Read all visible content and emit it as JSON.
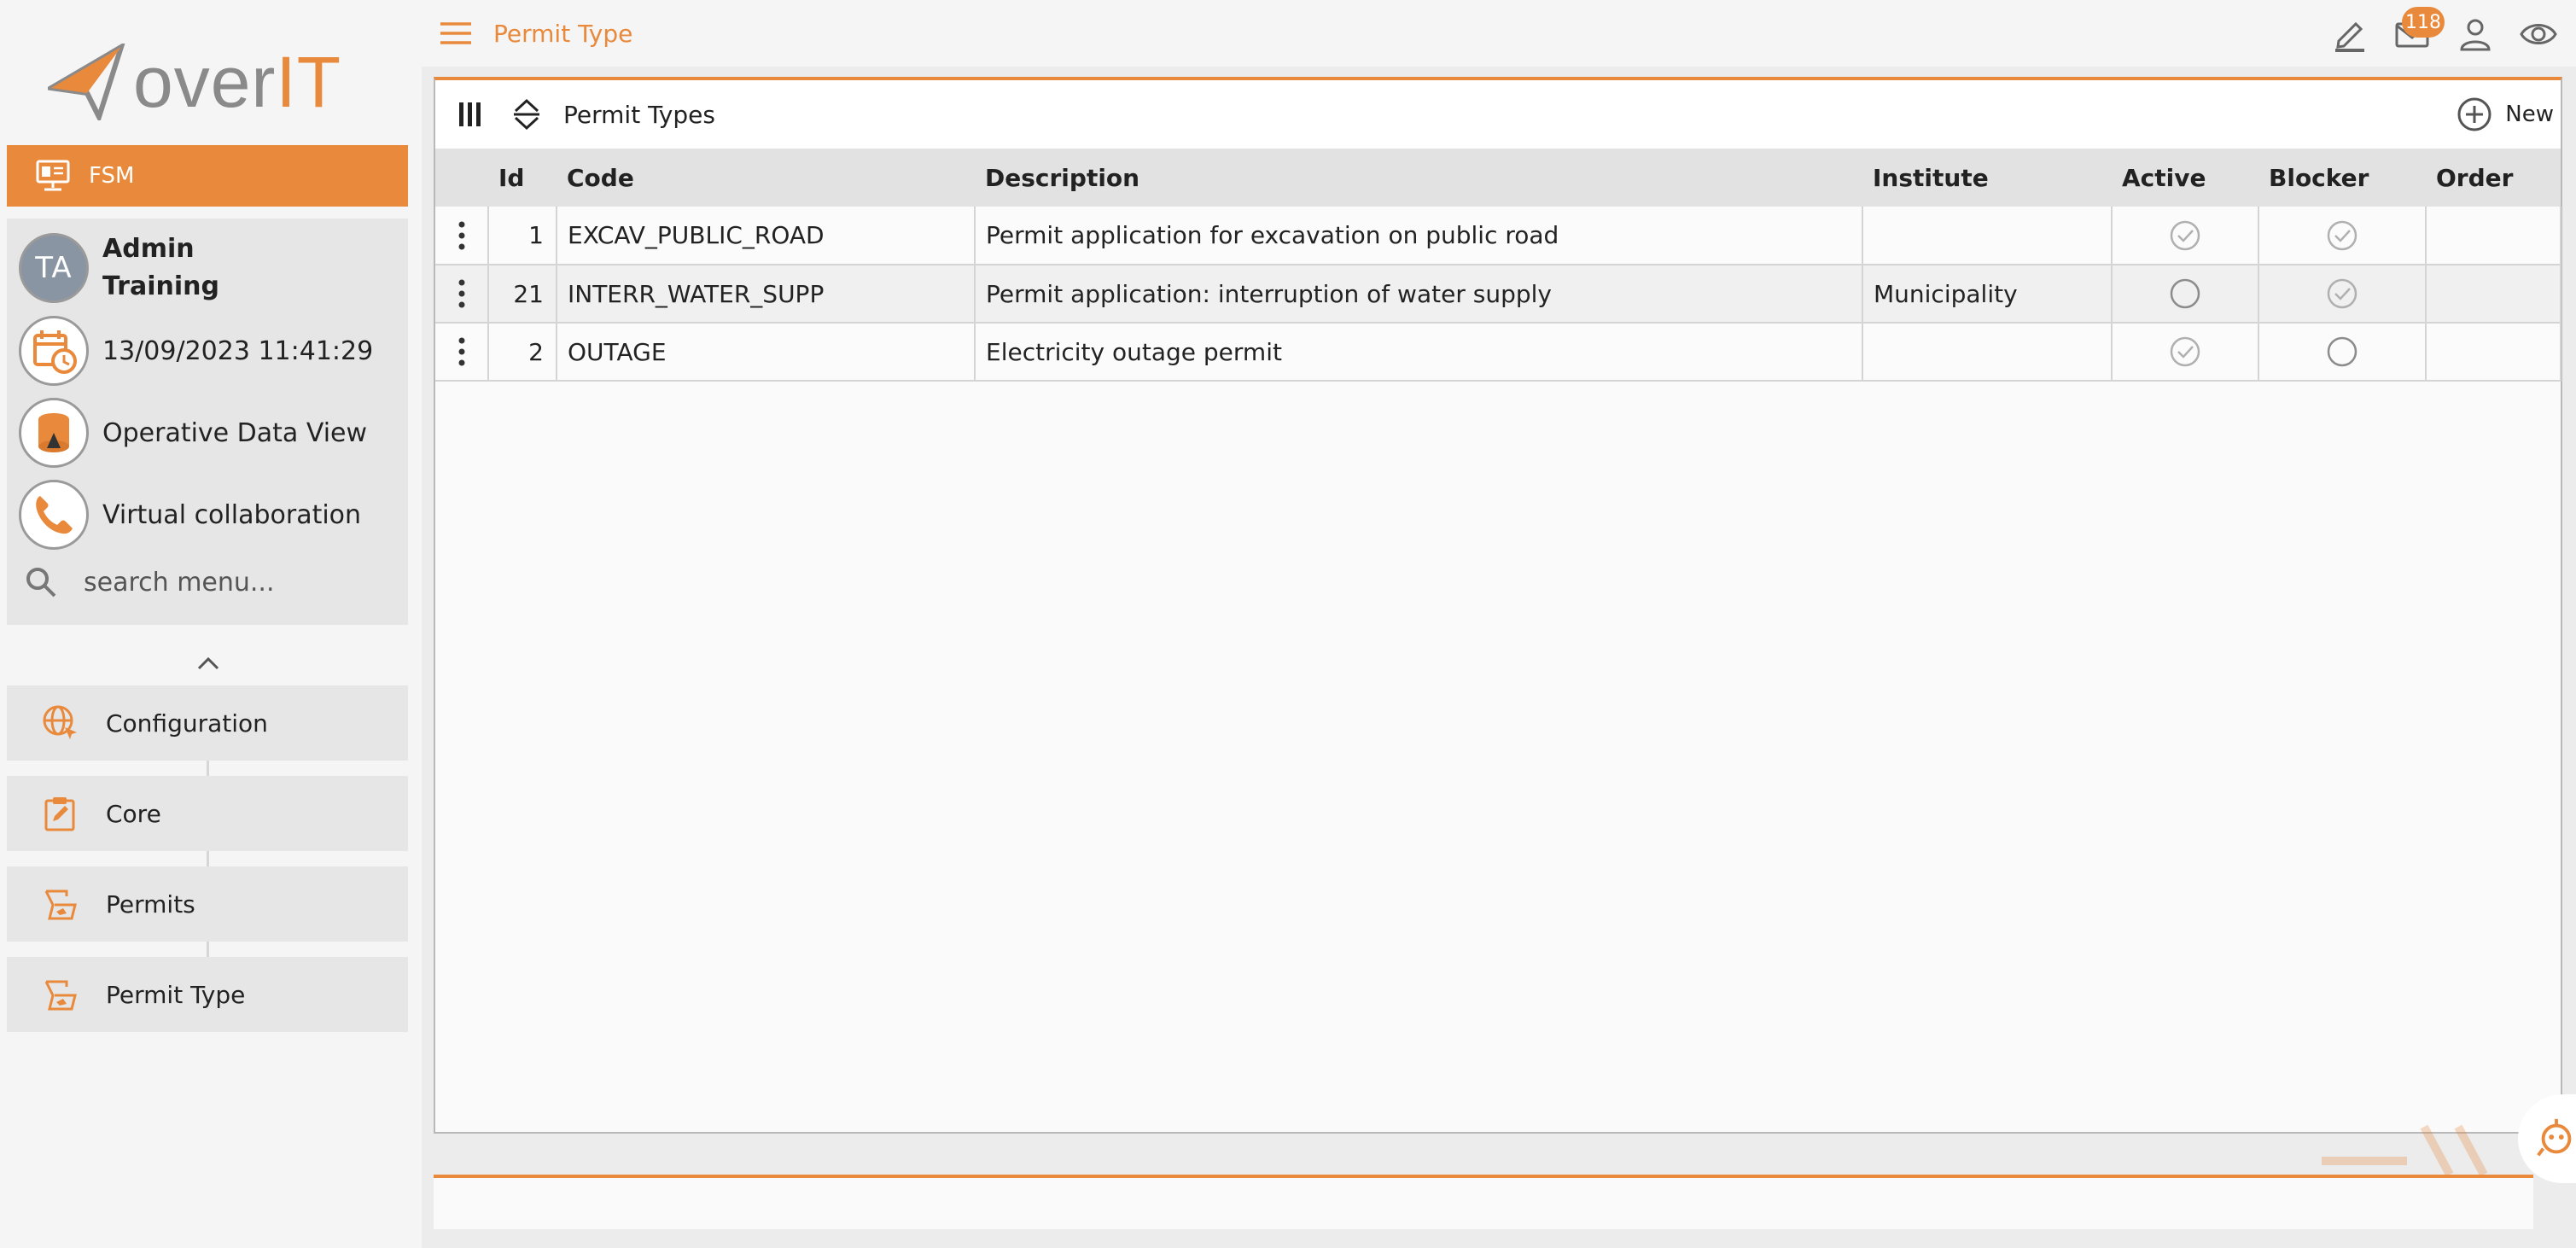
{
  "brand": {
    "name_left": "over",
    "name_right": "IT"
  },
  "colors": {
    "accent": "#e8893c",
    "sidebar_bg": "#f5f5f5",
    "panel_bg": "#e6e6e6"
  },
  "module": {
    "label": "FSM",
    "icon": "monitor-icon"
  },
  "user": {
    "initials": "TA",
    "first": "Admin",
    "last": "Training",
    "datetime": "13/09/2023 11:41:29",
    "operative": "Operative Data View",
    "virtual": "Virtual collaboration"
  },
  "search": {
    "placeholder": "search menu..."
  },
  "nav": [
    {
      "label": "Configuration",
      "icon": "globe-icon"
    },
    {
      "label": "Core",
      "icon": "clipboard-edit-icon"
    },
    {
      "label": "Permits",
      "icon": "permit-icon"
    },
    {
      "label": "Permit Type",
      "icon": "permit-icon"
    }
  ],
  "header": {
    "title": "Permit Type",
    "mail_count": "118",
    "icons": [
      "pencil-icon",
      "mail-icon",
      "user-icon",
      "eye-icon"
    ]
  },
  "panel": {
    "title": "Permit Types",
    "new_label": "New"
  },
  "table": {
    "columns": [
      "Id",
      "Code",
      "Description",
      "Institute",
      "Active",
      "Blocker",
      "Order"
    ],
    "rows": [
      {
        "id": "1",
        "code": "EXCAV_PUBLIC_ROAD",
        "description": "Permit application for excavation on public road",
        "institute": "",
        "active": true,
        "blocker": true,
        "order": ""
      },
      {
        "id": "21",
        "code": "INTERR_WATER_SUPP",
        "description": "Permit application: interruption of water supply",
        "institute": "Municipality",
        "active": false,
        "blocker": true,
        "order": ""
      },
      {
        "id": "2",
        "code": "OUTAGE",
        "description": "Electricity outage permit",
        "institute": "",
        "active": true,
        "blocker": false,
        "order": ""
      }
    ]
  }
}
